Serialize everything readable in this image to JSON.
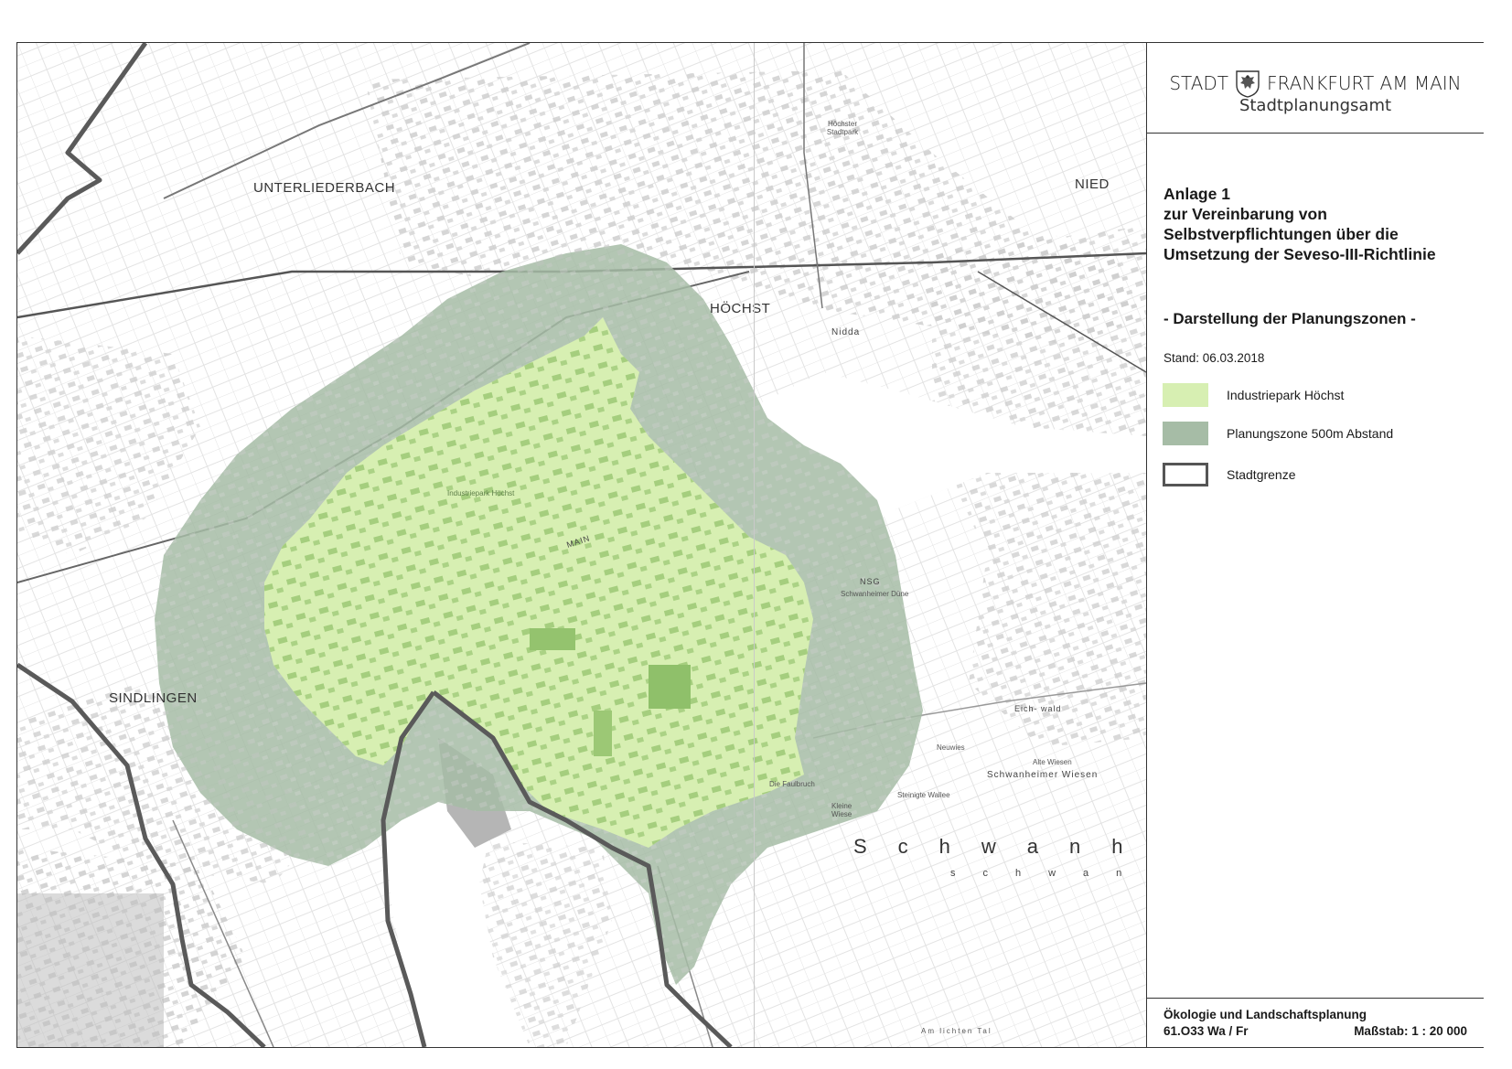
{
  "map": {
    "district_labels": {
      "unterliederbach": "UNTERLIEDERBACH",
      "nied": "NIED",
      "hoechst": "HÖCHST",
      "sindlingen": "SINDLINGEN"
    },
    "place_labels": {
      "industriepark": "Industriepark Höchst",
      "main": "MAIN",
      "nidda": "Nidda",
      "nsg": "NSG",
      "duene": "Schwanheimer Düne",
      "eichwald": "Eich-     wald",
      "schwanheimer_wiesen": "Schwanheimer Wiesen",
      "alte_wiesen": "Alte Wiesen",
      "hoechster_stadtpark": "Höchster Stadtpark",
      "neuwies": "Neuwies",
      "steinigte_wallee": "Steinigte Wallee",
      "kleine_wiese": "Kleine Wiese",
      "die_faulbruch": "Die Faulbruch",
      "am_lichten_tal": "Am lichten Tal",
      "schwanheim_big": "Schwanhe",
      "schwanheim_mid": "schwan"
    },
    "colors": {
      "zone_500m": "#a6bca6",
      "industriepark": "#d7efb2",
      "city_boundary": "#555555",
      "river": "#ffffff",
      "background": "#ffffff"
    }
  },
  "header": {
    "logo_word1": "STADT",
    "logo_word2": "FRANKFURT AM MAIN",
    "department": "Stadtplanungsamt",
    "crest_icon": "eagle-crest-icon"
  },
  "document": {
    "title_line1": "Anlage 1",
    "title_line2": "zur Vereinbarung von",
    "title_line3": "Selbstverpflichtungen über die",
    "title_line4": "Umsetzung der Seveso-III-Richtlinie",
    "subtitle": "- Darstellung der Planungszonen -",
    "stand": "Stand: 06.03.2018"
  },
  "legend": {
    "items": [
      {
        "label": "Industriepark Höchst",
        "color": "#d7efb2",
        "style": "fill"
      },
      {
        "label": "Planungszone  500m Abstand",
        "color": "#a6bca6",
        "style": "fill"
      },
      {
        "label": "Stadtgrenze",
        "color": "#555555",
        "style": "outline"
      }
    ]
  },
  "footer": {
    "department": "Ökologie und Landschaftsplanung",
    "code": "61.O33 Wa / Fr",
    "scale": "Maßstab: 1 : 20 000"
  }
}
